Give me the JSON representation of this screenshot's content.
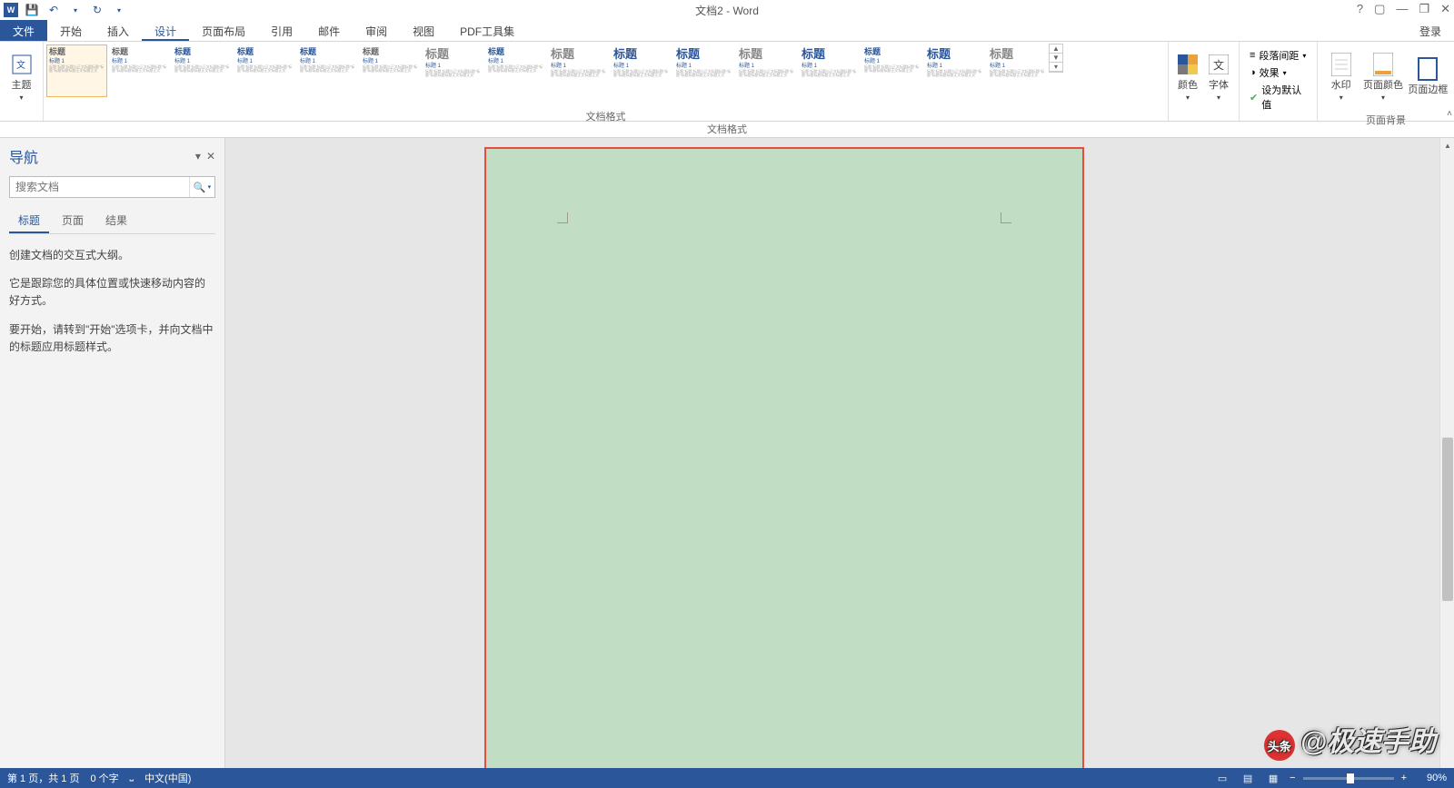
{
  "title": {
    "doc": "文档2 - Word",
    "app_badge": "W"
  },
  "qat": {
    "save": "💾",
    "undo": "↶",
    "redo": "↻",
    "more": "▾"
  },
  "win": {
    "help": "?",
    "ribbon_opts": "▢",
    "min": "—",
    "restore": "❐",
    "close": "✕"
  },
  "tabs": {
    "file": "文件",
    "home": "开始",
    "insert": "插入",
    "design": "设计",
    "layout": "页面布局",
    "references": "引用",
    "mailings": "邮件",
    "review": "审阅",
    "view": "视图",
    "pdf": "PDF工具集",
    "login": "登录"
  },
  "ribbon": {
    "themes_btn": "主题",
    "gallery": {
      "label": "文档格式",
      "items": [
        {
          "title": "标题",
          "sub": "标题 1",
          "cls": "",
          "sel": true
        },
        {
          "title": "标题",
          "sub": "标题 1",
          "cls": ""
        },
        {
          "title": "标题",
          "sub": "标题 1",
          "cls": "blue"
        },
        {
          "title": "标题",
          "sub": "标题 1",
          "cls": "blue"
        },
        {
          "title": "标题",
          "sub": "标题 1",
          "cls": "blue"
        },
        {
          "title": "标题",
          "sub": "标题 1",
          "cls": ""
        },
        {
          "title": "标题",
          "sub": "标题 1",
          "cls": "grey lg"
        },
        {
          "title": "标题",
          "sub": "标题 1",
          "cls": "blue"
        },
        {
          "title": "标题",
          "sub": "标题 1",
          "cls": "grey lg"
        },
        {
          "title": "标题",
          "sub": "标题 1",
          "cls": "blue lg"
        },
        {
          "title": "标题",
          "sub": "标题 1",
          "cls": "blue lg"
        },
        {
          "title": "标题",
          "sub": "标题 1",
          "cls": "grey lg"
        },
        {
          "title": "标题",
          "sub": "标题 1",
          "cls": "blue lg"
        },
        {
          "title": "标题",
          "sub": "标题 1",
          "cls": "blue"
        },
        {
          "title": "标题",
          "sub": "标题 1",
          "cls": "blue lg"
        },
        {
          "title": "标题",
          "sub": "标题 1",
          "cls": "grey lg"
        }
      ]
    },
    "colors": "颜色",
    "fonts": "字体",
    "spacing": "段落间距",
    "effects": "效果",
    "default": "设为默认值",
    "page_bg_label": "页面背景",
    "watermark_b": "水印",
    "page_color": "页面颜色",
    "page_border": "页面边框"
  },
  "docfmt_label": "文档格式",
  "nav": {
    "title": "导航",
    "search_placeholder": "搜索文档",
    "tabs": {
      "headings": "标题",
      "pages": "页面",
      "results": "结果"
    },
    "msg1": "创建文档的交互式大纲。",
    "msg2": "它是跟踪您的具体位置或快速移动内容的好方式。",
    "msg3": "要开始，请转到\"开始\"选项卡，并向文档中的标题应用标题样式。",
    "dd": "▾",
    "close": "✕"
  },
  "status": {
    "page": "第 1 页，共 1 页",
    "words": "0 个字",
    "lang_icon": "⎵",
    "lang": "中文(中国)",
    "zoom": "90%"
  },
  "watermark": {
    "badge": "头条",
    "text": "@极速手助"
  }
}
